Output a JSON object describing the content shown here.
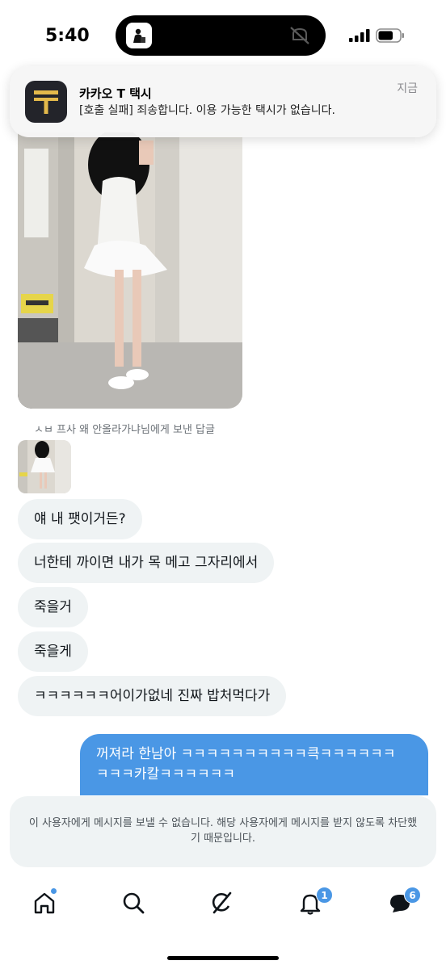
{
  "status_bar": {
    "time": "5:40",
    "battery_level": 0.7
  },
  "notification": {
    "app_name": "카카오 T 택시",
    "message": "[호출 실패] 죄송합니다. 이용 가능한 택시가 없습니다.",
    "time": "지금",
    "icon": "kakao-t-icon"
  },
  "chat": {
    "reply_label": "ㅅㅂ 프사 왜 안올라가냐님에게 보낸 답글",
    "incoming_messages": [
      "얘 내 팻이거든?",
      "너한테 까이면 내가 목 메고 그자리에서",
      "죽을거",
      "죽을게",
      "ㅋㅋㅋㅋㅋㅋ어이가없네 진짜 밥처먹다가"
    ],
    "outgoing_message": "꺼져라 한남아 ㅋㅋㅋㅋㅋㅋㅋㅋㅋㅋ큭ㅋㅋㅋㅋㅋㅋ ㅋㅋㅋ카칼ㅋㅋㅋㅋㅋㅋ"
  },
  "blocked_notice": {
    "text": "이 사용자에게 메시지를 보낼 수 없습니다. 해당 사용자에게 메시지를 받지 않도록 차단했기 때문입니다."
  },
  "tabbar": {
    "items": [
      {
        "icon": "home-icon"
      },
      {
        "icon": "search-icon"
      },
      {
        "icon": "grok-icon"
      },
      {
        "icon": "bell-icon",
        "badge": "1"
      },
      {
        "icon": "messages-icon",
        "badge": "6"
      }
    ]
  },
  "colors": {
    "accent": "#4a97e5",
    "bubble_in": "#eff3f4",
    "text": "#0f1419"
  }
}
